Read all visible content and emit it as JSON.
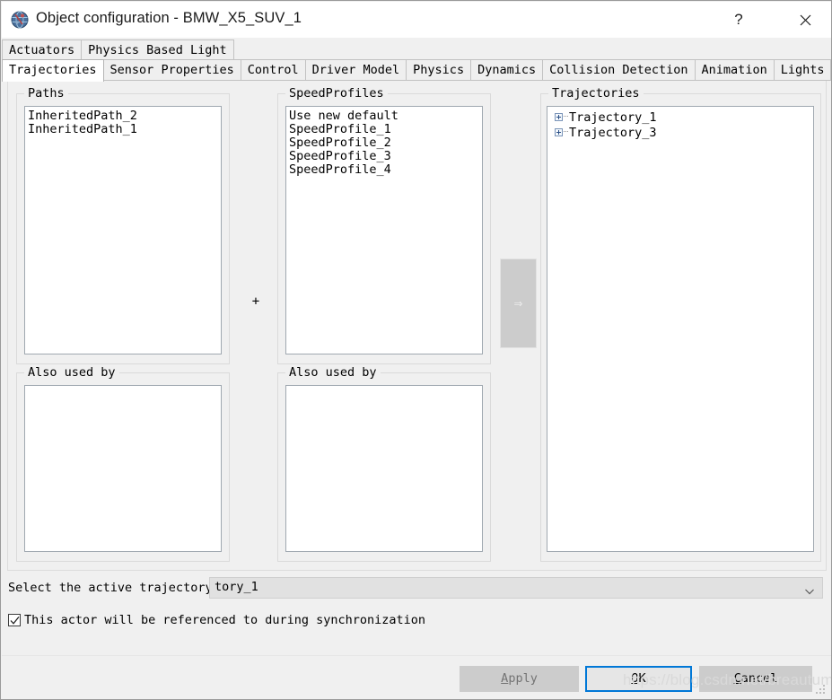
{
  "window": {
    "title": "Object configuration - BMW_X5_SUV_1",
    "app_icon": "globe-icon",
    "help_label": "?",
    "close_label": "close-icon"
  },
  "tabs": {
    "top_row": [
      {
        "label": "Actuators",
        "selected": false
      },
      {
        "label": "Physics Based Light",
        "selected": false
      }
    ],
    "bottom_row": [
      {
        "label": "Trajectories",
        "selected": true
      },
      {
        "label": "Sensor Properties",
        "selected": false
      },
      {
        "label": "Control",
        "selected": false
      },
      {
        "label": "Driver Model",
        "selected": false
      },
      {
        "label": "Physics",
        "selected": false
      },
      {
        "label": "Dynamics",
        "selected": false
      },
      {
        "label": "Collision Detection",
        "selected": false
      },
      {
        "label": "Animation",
        "selected": false
      },
      {
        "label": "Lights",
        "selected": false
      }
    ]
  },
  "panels": {
    "paths": {
      "title": "Paths",
      "items": [
        "InheritedPath_2",
        "InheritedPath_1"
      ]
    },
    "speed_profiles": {
      "title": "SpeedProfiles",
      "items": [
        "Use new default",
        "SpeedProfile_1",
        "SpeedProfile_2",
        "SpeedProfile_3",
        "SpeedProfile_4"
      ]
    },
    "trajectories": {
      "title": "Trajectories",
      "items": [
        "Trajectory_1",
        "Trajectory_3"
      ]
    },
    "also_used_by_paths": {
      "title": "Also used by",
      "items": []
    },
    "also_used_by_speed": {
      "title": "Also used by",
      "items": []
    }
  },
  "middle": {
    "plus_label": "+",
    "transfer_label": "⇒",
    "transfer_icon": "arrow-right-icon"
  },
  "bottom": {
    "active_trajectory_label": "Select the active trajectory:",
    "active_trajectory_value": "tory_1",
    "combo_arrow_icon": "chevron-down-icon",
    "sync_checkbox_label": "This actor will be referenced to during synchronization",
    "sync_checkbox_checked": true
  },
  "buttons": {
    "apply": {
      "accel": "A",
      "rest": "pply",
      "enabled": false
    },
    "ok": {
      "accel": "O",
      "rest": "K",
      "enabled": true,
      "default": true
    },
    "cancel": {
      "accel": "C",
      "rest": "ancel",
      "enabled": true
    }
  },
  "watermark": "https://blog.csdn.net/breautumn",
  "colors": {
    "accent": "#0078d7",
    "dialog_bg": "#f0f0f0",
    "list_bg": "#ffffff",
    "disabled_text": "#737373"
  }
}
